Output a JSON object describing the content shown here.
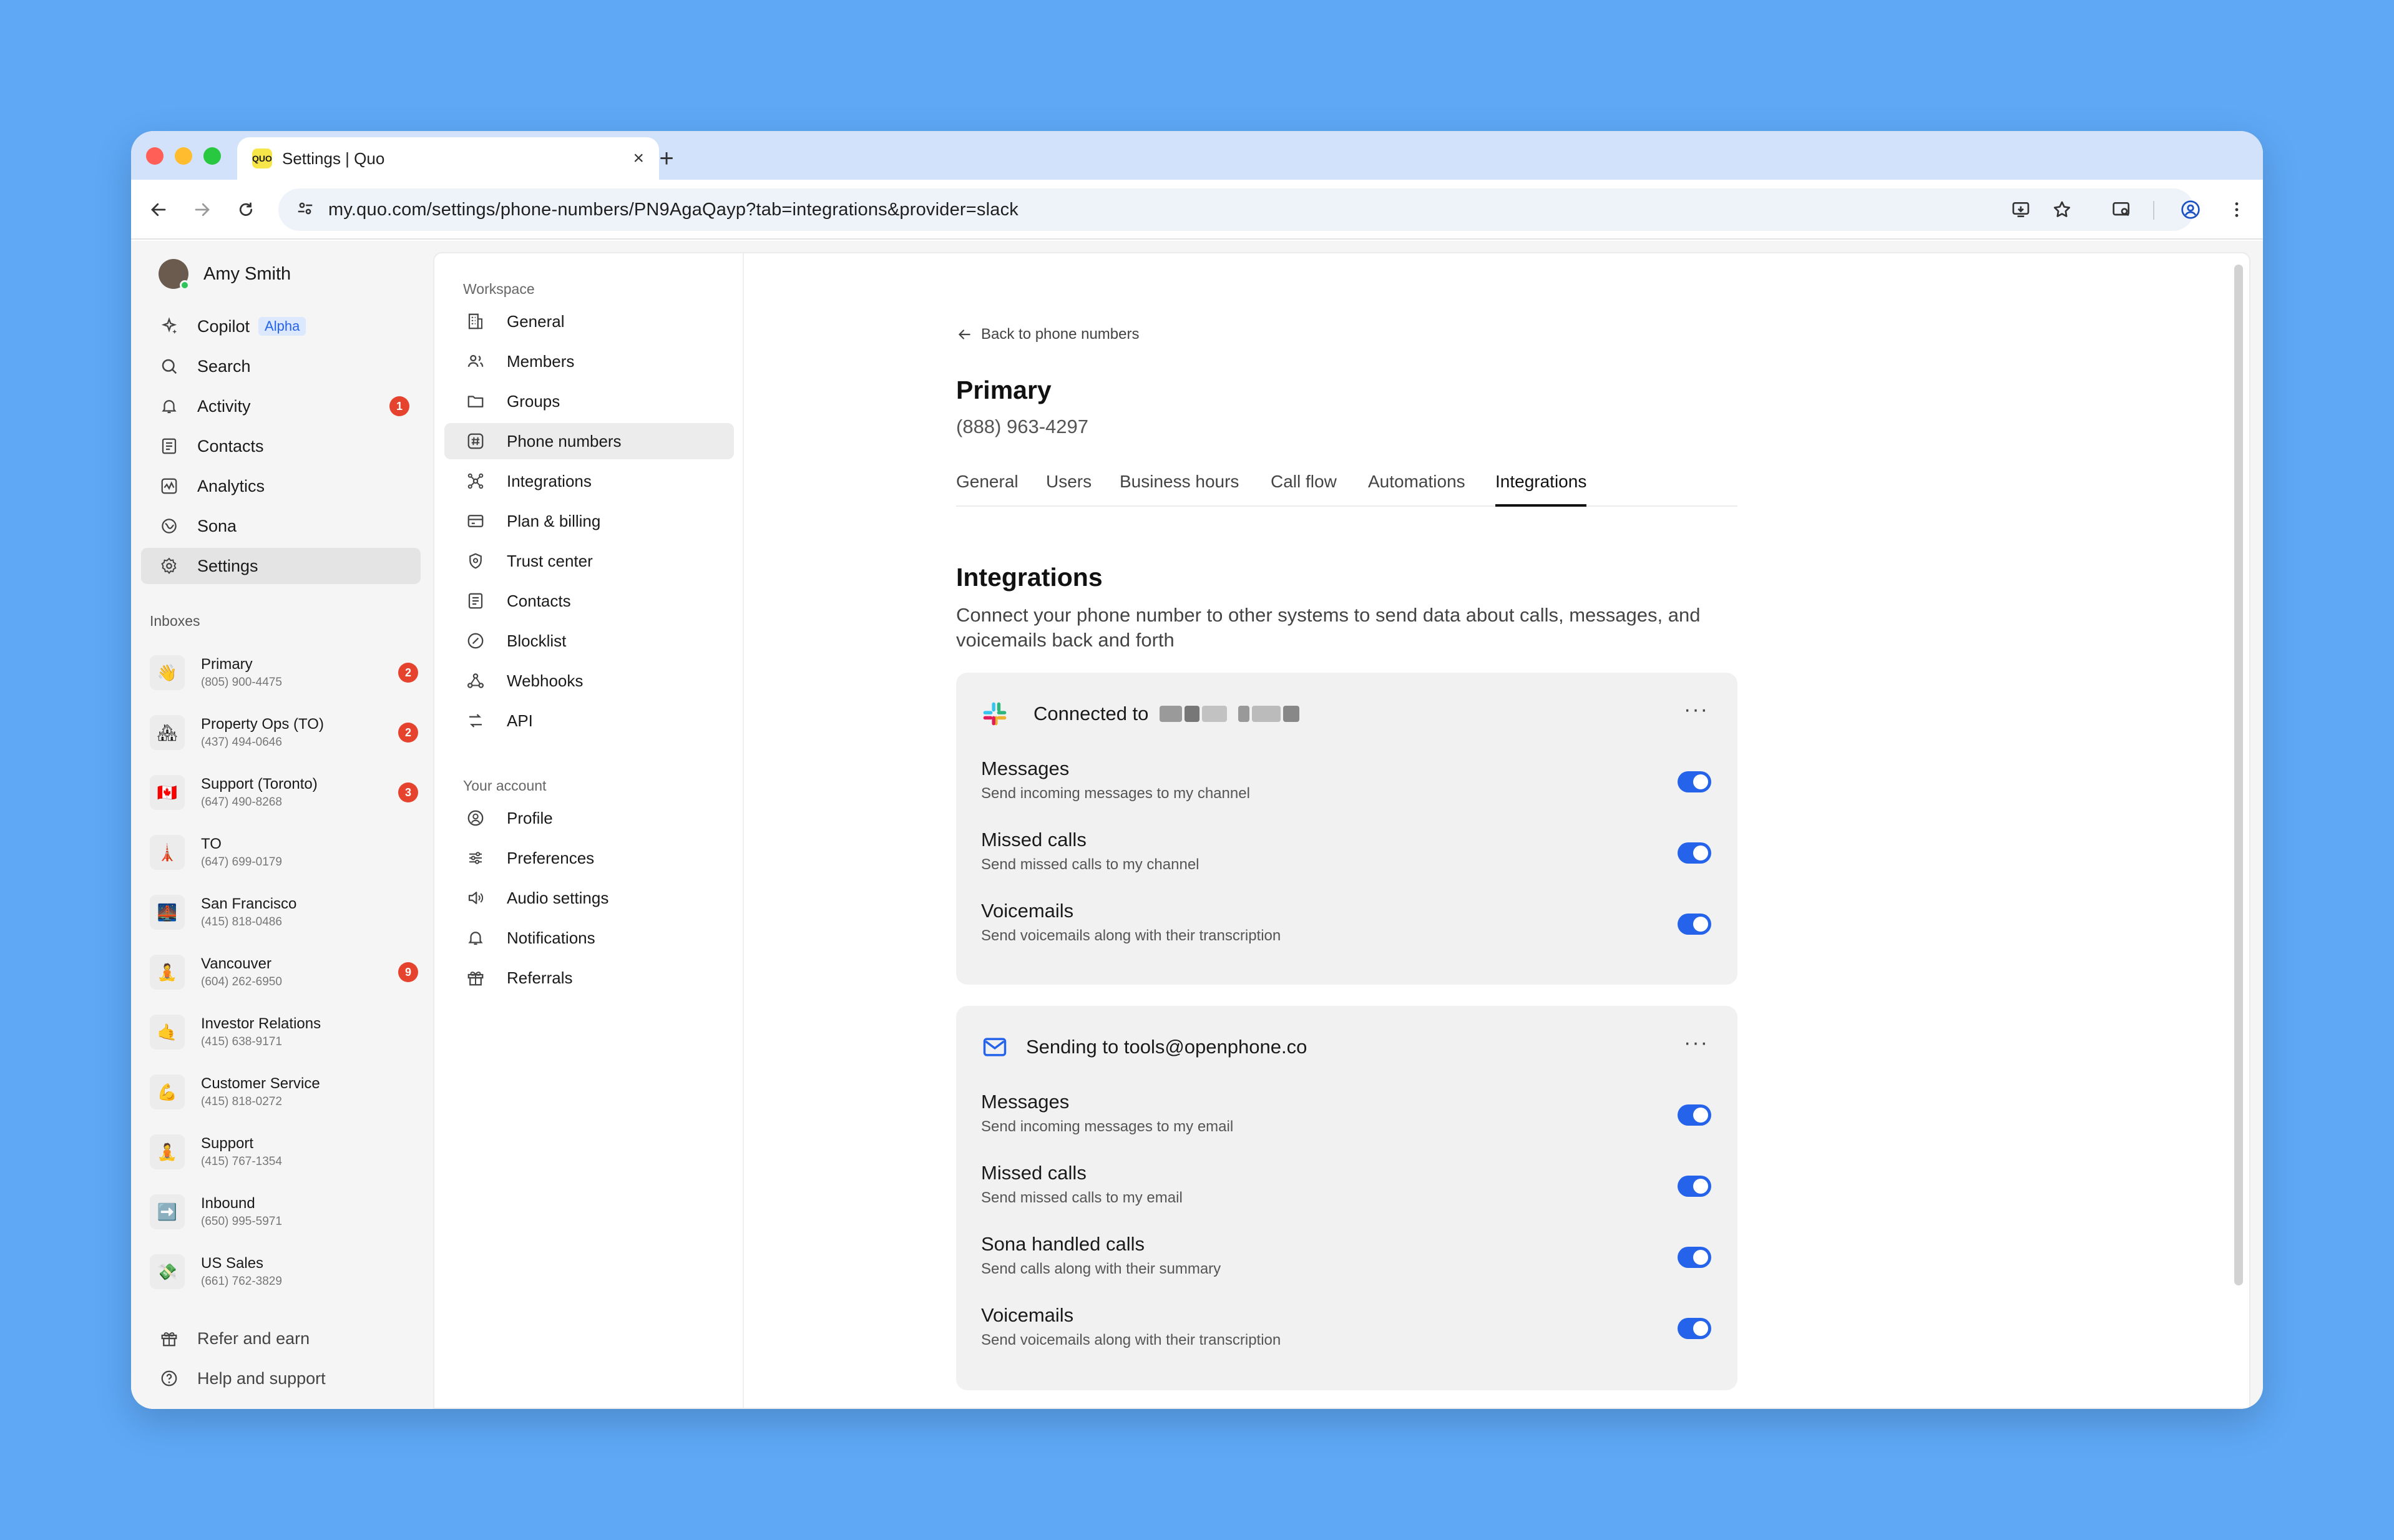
{
  "browser": {
    "tab_title": "Settings | Quo",
    "favicon_text": "QUO",
    "url": "my.quo.com/settings/phone-numbers/PN9AgaQayp?tab=integrations&provider=slack"
  },
  "sidebar": {
    "user_name": "Amy Smith",
    "nav": [
      {
        "label": "Copilot",
        "tag": "Alpha",
        "icon": "sparkle-icon"
      },
      {
        "label": "Search",
        "icon": "search-icon"
      },
      {
        "label": "Activity",
        "badge": "1",
        "icon": "bell-icon"
      },
      {
        "label": "Contacts",
        "icon": "contacts-icon"
      },
      {
        "label": "Analytics",
        "icon": "analytics-icon"
      },
      {
        "label": "Sona",
        "icon": "sona-icon"
      },
      {
        "label": "Settings",
        "icon": "gear-icon"
      }
    ],
    "inboxes_label": "Inboxes",
    "inboxes": [
      {
        "name": "Primary",
        "phone": "(805) 900-4475",
        "emoji": "👋",
        "badge": "2"
      },
      {
        "name": "Property Ops (TO)",
        "phone": "(437) 494-0646",
        "emoji": "🏘",
        "badge": "2"
      },
      {
        "name": "Support (Toronto)",
        "phone": "(647) 490-8268",
        "emoji": "🇨🇦",
        "badge": "3"
      },
      {
        "name": "TO",
        "phone": "(647) 699-0179",
        "emoji": "🗼",
        "badge": ""
      },
      {
        "name": "San Francisco",
        "phone": "(415) 818-0486",
        "emoji": "🌉",
        "badge": ""
      },
      {
        "name": "Vancouver",
        "phone": "(604) 262-6950",
        "emoji": "🧘",
        "badge": "9"
      },
      {
        "name": "Investor Relations",
        "phone": "(415) 638-9171",
        "emoji": "🤙",
        "badge": ""
      },
      {
        "name": "Customer Service",
        "phone": "(415) 818-0272",
        "emoji": "💪",
        "badge": ""
      },
      {
        "name": "Support",
        "phone": "(415) 767-1354",
        "emoji": "🧘",
        "badge": ""
      },
      {
        "name": "Inbound",
        "phone": "(650) 995-5971",
        "emoji": "➡️",
        "badge": ""
      },
      {
        "name": "US Sales",
        "phone": "(661) 762-3829",
        "emoji": "💸",
        "badge": ""
      }
    ],
    "footer": [
      {
        "label": "Refer and earn",
        "icon": "gift-icon"
      },
      {
        "label": "Help and support",
        "icon": "help-icon"
      }
    ]
  },
  "subnav": {
    "workspace_label": "Workspace",
    "workspace": [
      {
        "label": "General",
        "icon": "building-icon"
      },
      {
        "label": "Members",
        "icon": "members-icon"
      },
      {
        "label": "Groups",
        "icon": "folder-icon"
      },
      {
        "label": "Phone numbers",
        "icon": "hash-icon"
      },
      {
        "label": "Integrations",
        "icon": "integrations-icon"
      },
      {
        "label": "Plan & billing",
        "icon": "card-icon"
      },
      {
        "label": "Trust center",
        "icon": "shield-icon"
      },
      {
        "label": "Contacts",
        "icon": "contacts-icon"
      },
      {
        "label": "Blocklist",
        "icon": "block-icon"
      },
      {
        "label": "Webhooks",
        "icon": "webhook-icon"
      },
      {
        "label": "API",
        "icon": "api-icon"
      }
    ],
    "account_label": "Your account",
    "account": [
      {
        "label": "Profile",
        "icon": "profile-icon"
      },
      {
        "label": "Preferences",
        "icon": "sliders-icon"
      },
      {
        "label": "Audio settings",
        "icon": "speaker-icon"
      },
      {
        "label": "Notifications",
        "icon": "bell-icon"
      },
      {
        "label": "Referrals",
        "icon": "gift-icon"
      }
    ]
  },
  "main": {
    "back_label": "Back to phone numbers",
    "title": "Primary",
    "phone": "(888) 963-4297",
    "tabs": [
      "General",
      "Users",
      "Business hours",
      "Call flow",
      "Automations",
      "Integrations"
    ],
    "active_tab": "Integrations",
    "section_title": "Integrations",
    "section_desc": "Connect your phone number to other systems to send data about calls, messages, and voicemails back and forth",
    "slack_card": {
      "heading": "Connected to",
      "rows": [
        {
          "title": "Messages",
          "sub": "Send incoming messages to my channel",
          "on": true
        },
        {
          "title": "Missed calls",
          "sub": "Send missed calls to my channel",
          "on": true
        },
        {
          "title": "Voicemails",
          "sub": "Send voicemails along with their transcription",
          "on": true
        }
      ]
    },
    "email_card": {
      "heading": "Sending to tools@openphone.co",
      "rows": [
        {
          "title": "Messages",
          "sub": "Send incoming messages to my email",
          "on": true
        },
        {
          "title": "Missed calls",
          "sub": "Send missed calls to my email",
          "on": true
        },
        {
          "title": "Sona handled calls",
          "sub": "Send calls along with their summary",
          "on": true
        },
        {
          "title": "Voicemails",
          "sub": "Send voicemails along with their transcription",
          "on": true
        }
      ]
    },
    "more_label": "···"
  },
  "colors": {
    "accent": "#2563eb",
    "badge": "#e5432d",
    "background": "#5ea8f6"
  }
}
